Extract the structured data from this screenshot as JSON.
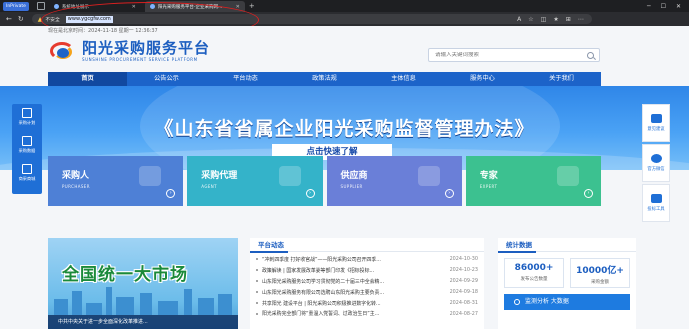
{
  "browser": {
    "inprivate_label": "InPrivate",
    "tabs": [
      {
        "label": "系统地址展示"
      },
      {
        "label": "阳光采购服务平台-企业采购网..."
      }
    ],
    "new_tab": "+",
    "security_label": "不安全",
    "url": "www.ygcgfw.com"
  },
  "page": {
    "topline": "现在是北京时间：2024-11-18 星期一 12:36:37",
    "logo": {
      "cn": "阳光采购服务平台",
      "en": "SUNSHINE PROCUREMENT SERVICE PLATFORM"
    },
    "search": {
      "placeholder": "请输入关键词搜索"
    },
    "nav": [
      "首页",
      "公告公示",
      "平台动态",
      "政策法规",
      "主体信息",
      "服务中心",
      "关于我们"
    ],
    "banner": {
      "title": "《山东省省属企业阳光采购监督管理办法》",
      "button": "点击快速了解"
    },
    "left_dock": [
      "采购计划",
      "采购数据",
      "商采商城"
    ],
    "right_dock": [
      "意见建议",
      "官方微信",
      "投标工具"
    ],
    "cards": [
      {
        "cn": "采购人",
        "en": "PURCHASER"
      },
      {
        "cn": "采购代理",
        "en": "AGENT"
      },
      {
        "cn": "供应商",
        "en": "SUPPLIER"
      },
      {
        "cn": "专家",
        "en": "EXPERT"
      }
    ],
    "hero": {
      "title": "全国统一大市场",
      "caption": "中共中央关于进一步全面深化改革推进..."
    },
    "news": {
      "title": "平台动态",
      "items": [
        {
          "text": "“冲刺四季度 打好收官战”——阳光采购公司召开四季...",
          "date": "2024-10-30"
        },
        {
          "text": "政策解读 | 国家发展改革委等部门印发《招标投标...",
          "date": "2024-10-23"
        },
        {
          "text": "山东阳光采购服务公司学习贯彻党的二十届三中全会精...",
          "date": "2024-09-29"
        },
        {
          "text": "山东阳光采购服务有限公司选聘山东阳光采购主要负责...",
          "date": "2024-09-18"
        },
        {
          "text": "共享阳光 建设平台 | 阳光采购公司积极推进数字化转...",
          "date": "2024-08-31"
        },
        {
          "text": "阳光采购完全部门将“重温入党誓词、过政治生日”主...",
          "date": "2024-08-27"
        }
      ]
    },
    "stats": {
      "title": "统计数据",
      "items": [
        {
          "num": "86000+",
          "label": "发布公告数量"
        },
        {
          "num": "10000亿+",
          "label": "采购金额"
        }
      ],
      "monitor": "监测分析 大数据"
    }
  },
  "colors": {
    "brand": "#1c63c9",
    "annotation": "#d92020"
  }
}
